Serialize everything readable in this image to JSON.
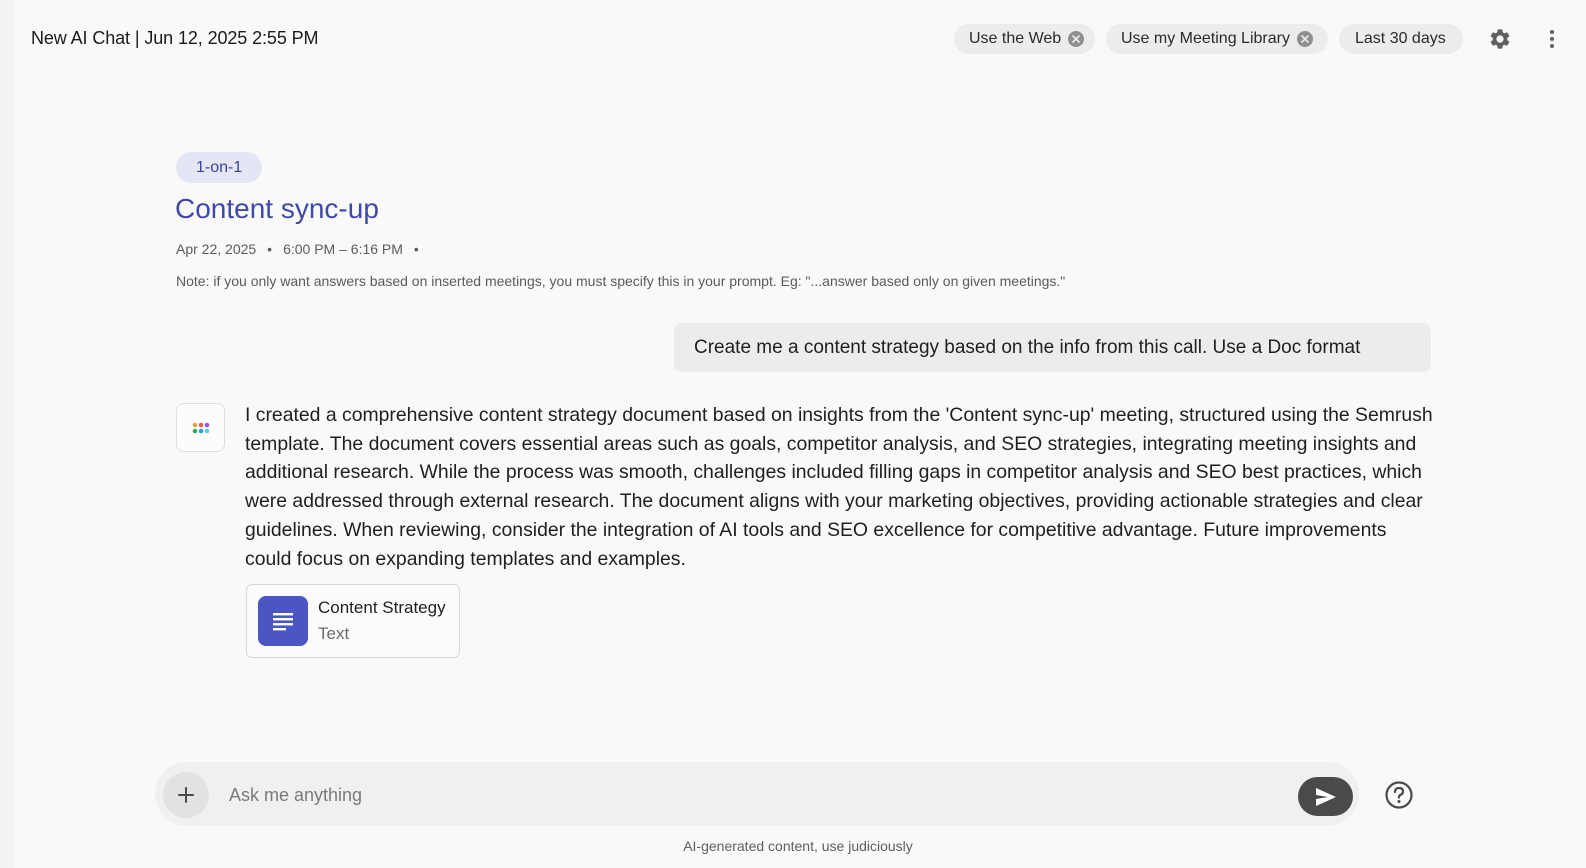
{
  "header": {
    "title": "New AI Chat | Jun 12, 2025 2:55 PM",
    "chips": [
      {
        "label": "Use the Web",
        "removable": true
      },
      {
        "label": "Use my Meeting Library",
        "removable": true
      },
      {
        "label": "Last 30 days",
        "removable": false
      }
    ],
    "settings_icon": "gear-icon",
    "more_icon": "kebab-menu-icon"
  },
  "meeting": {
    "tag": "1-on-1",
    "title": "Content sync-up",
    "date": "Apr 22, 2025",
    "time": "6:00 PM – 6:16 PM",
    "separator": "•",
    "note": "Note: if you only want answers based on inserted meetings, you must specify this in your prompt. Eg: \"...answer based only on given meetings.\""
  },
  "conversation": {
    "user_message": "Create me a content strategy based on the info from this call. Use a Doc format",
    "assistant_message": "I created a comprehensive content strategy document based on insights from the 'Content sync-up' meeting, structured using the Semrush template. The document covers essential areas such as goals, competitor analysis, and SEO strategies, integrating meeting insights and additional research. While the process was smooth, challenges included filling gaps in competitor analysis and SEO best practices, which were addressed through external research. The document aligns with your marketing objectives, providing actionable strategies and clear guidelines. When reviewing, consider the integration of AI tools and SEO excellence for competitive advantage. Future improvements could focus on expanding templates and examples.",
    "attachment": {
      "name": "Content Strategy",
      "type": "Text",
      "icon": "document-icon"
    }
  },
  "composer": {
    "placeholder": "Ask me anything",
    "value": "",
    "add_icon": "plus-icon",
    "send_icon": "send-icon",
    "help_icon": "help-icon"
  },
  "footer": {
    "disclaimer": "AI-generated content, use judiciously"
  },
  "colors": {
    "accent": "#3f4aa8",
    "tag_bg": "#e5e6f5",
    "doc_icon_bg": "#4c55c4",
    "send_bg": "#4a4a4a"
  }
}
